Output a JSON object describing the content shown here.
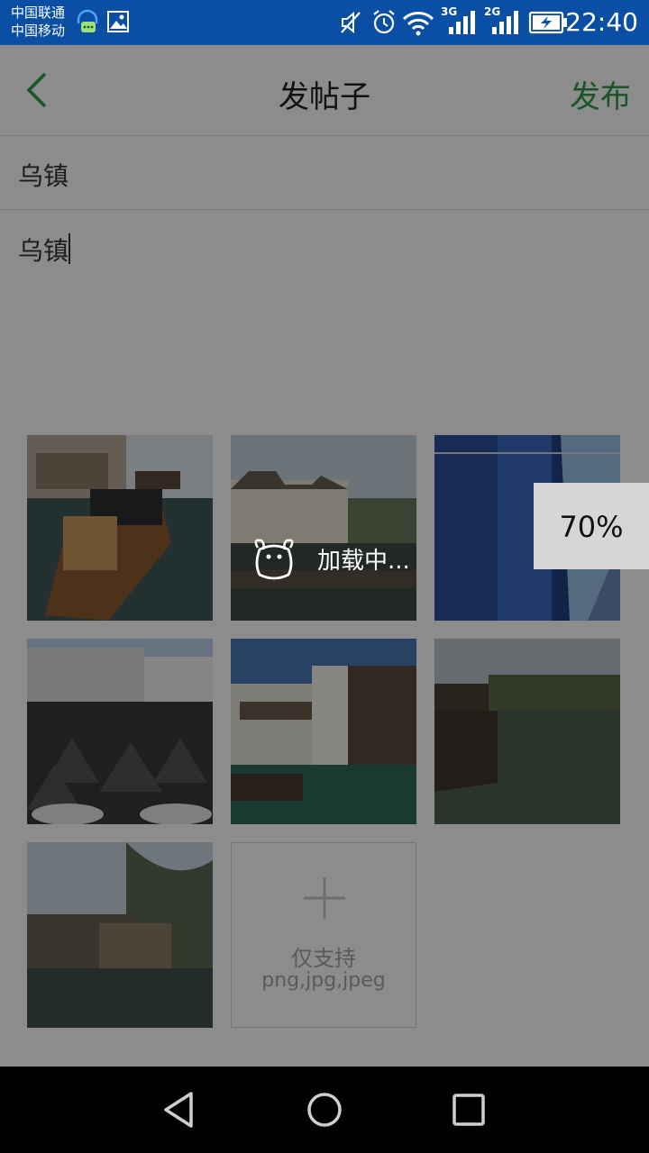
{
  "status_bar": {
    "carrier_1": "中国联通",
    "carrier_2": "中国移动",
    "network_1": "3G",
    "network_2": "2G",
    "time": "22:40",
    "icons": [
      "headset-chat-icon",
      "image-icon",
      "mute-icon",
      "alarm-icon",
      "wifi-icon",
      "signal-icon",
      "battery-charging-icon"
    ]
  },
  "header": {
    "back_icon": "chevron-left-icon",
    "title": "发帖子",
    "publish_label": "发布"
  },
  "form": {
    "title_value": "乌镇",
    "body_value": "乌镇"
  },
  "images": {
    "count": 7,
    "items": [
      {
        "subject": "canal-boats"
      },
      {
        "subject": "white-wall-buildings",
        "loading_label": "加载中..."
      },
      {
        "subject": "blue-dyed-fabric"
      },
      {
        "subject": "straw-cones-roofs"
      },
      {
        "subject": "canal-houses"
      },
      {
        "subject": "long-canal"
      },
      {
        "subject": "willow-bridge"
      }
    ],
    "add_tile": {
      "icon": "plus-icon",
      "line1": "仅支持",
      "line2": "png,jpg,jpeg"
    }
  },
  "upload": {
    "progress_text": "70%",
    "progress_fraction": 0.7
  },
  "nav_bar": {
    "icons": [
      "back-triangle-icon",
      "home-circle-icon",
      "recents-square-icon"
    ]
  },
  "colors": {
    "status_bar": "#0a4fa3",
    "accent_green": "#2e9c48",
    "overlay": "rgba(0,0,0,0.45)"
  }
}
